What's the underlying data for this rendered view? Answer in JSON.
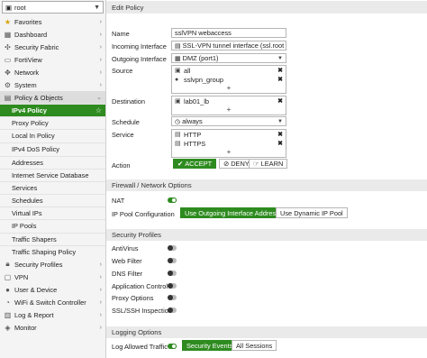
{
  "sidebar": {
    "vdom": "root",
    "items_top": [
      {
        "label": "Favorites",
        "icon": "star-icon"
      },
      {
        "label": "Dashboard",
        "icon": "dashboard-icon"
      },
      {
        "label": "Security Fabric",
        "icon": "security-fabric-icon"
      },
      {
        "label": "FortiView",
        "icon": "fortiview-icon"
      },
      {
        "label": "Network",
        "icon": "network-icon"
      },
      {
        "label": "System",
        "icon": "gear-icon"
      },
      {
        "label": "Policy & Objects",
        "icon": "policy-icon"
      }
    ],
    "sub_items": [
      "IPv4 Policy",
      "Proxy Policy",
      "Local In Policy",
      "IPv4 DoS Policy",
      "Addresses",
      "Internet Service Database",
      "Services",
      "Schedules",
      "Virtual IPs",
      "IP Pools",
      "Traffic Shapers",
      "Traffic Shaping Policy"
    ],
    "items_bottom": [
      {
        "label": "Security Profiles",
        "icon": "lock-icon"
      },
      {
        "label": "VPN",
        "icon": "vpn-icon"
      },
      {
        "label": "User & Device",
        "icon": "user-icon"
      },
      {
        "label": "WiFi & Switch Controller",
        "icon": "wifi-icon"
      },
      {
        "label": "Log & Report",
        "icon": "log-icon"
      },
      {
        "label": "Monitor",
        "icon": "monitor-icon"
      }
    ]
  },
  "header": {
    "title": "Edit Policy"
  },
  "form": {
    "name_label": "Name",
    "name_value": "sslVPN webaccess",
    "incoming_label": "Incoming Interface",
    "incoming_value": "SSL-VPN tunnel interface (ssl.root",
    "outgoing_label": "Outgoing Interface",
    "outgoing_value": "DMZ (port1)",
    "source_label": "Source",
    "source_items": [
      "all",
      "sslvpn_group"
    ],
    "destination_label": "Destination",
    "destination_items": [
      "lab01_lb"
    ],
    "schedule_label": "Schedule",
    "schedule_value": "always",
    "service_label": "Service",
    "service_items": [
      "HTTP",
      "HTTPS"
    ],
    "action_label": "Action",
    "action_accept": "ACCEPT",
    "action_deny": "DENY",
    "action_learn": "LEARN"
  },
  "firewall": {
    "title": "Firewall / Network Options",
    "nat_label": "NAT",
    "nat_enabled": true,
    "pool_label": "IP Pool Configuration",
    "pool_outgoing": "Use Outgoing Interface Address",
    "pool_dynamic": "Use Dynamic IP Pool"
  },
  "profiles": {
    "title": "Security Profiles",
    "items": [
      "AntiVirus",
      "Web Filter",
      "DNS Filter",
      "Application Control",
      "Proxy Options",
      "SSL/SSH Inspection"
    ]
  },
  "logging": {
    "title": "Logging Options",
    "log_label": "Log Allowed Traffic",
    "log_enabled": true,
    "security_events": "Security Events",
    "all_sessions": "All Sessions"
  },
  "colors": {
    "accent": "#2e8b1f"
  }
}
